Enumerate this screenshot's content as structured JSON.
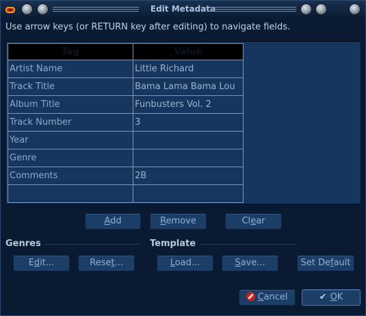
{
  "window": {
    "title": "Edit Metadata"
  },
  "instructions": "Use arrow keys (or RETURN key after editing) to navigate fields.",
  "table": {
    "headers": {
      "tag": "Tag",
      "value": "Value"
    },
    "rows": [
      {
        "tag": "Artist Name",
        "value": "Little Richard"
      },
      {
        "tag": "Track Title",
        "value": "Bama Lama Bama Lou"
      },
      {
        "tag": "Album Title",
        "value": "Funbusters Vol. 2"
      },
      {
        "tag": "Track Number",
        "value": "3"
      },
      {
        "tag": "Year",
        "value": ""
      },
      {
        "tag": "Genre",
        "value": ""
      },
      {
        "tag": "Comments",
        "value": "2B"
      },
      {
        "tag": "",
        "value": ""
      }
    ]
  },
  "buttons": {
    "add": {
      "pre": "",
      "accel": "A",
      "post": "dd"
    },
    "remove": {
      "pre": "",
      "accel": "R",
      "post": "emove"
    },
    "clear": {
      "pre": "Cl",
      "accel": "e",
      "post": "ar"
    },
    "genres_edit": {
      "pre": "E",
      "accel": "d",
      "post": "it..."
    },
    "genres_reset": {
      "pre": "Rese",
      "accel": "t",
      "post": "..."
    },
    "template_load": {
      "pre": "",
      "accel": "L",
      "post": "oad..."
    },
    "template_save": {
      "pre": "",
      "accel": "S",
      "post": "ave..."
    },
    "set_default": {
      "pre": "Set De",
      "accel": "f",
      "post": "ault"
    },
    "cancel": {
      "pre": "",
      "accel": "C",
      "post": "ancel"
    },
    "ok": {
      "pre": "",
      "accel": "O",
      "post": "K"
    }
  },
  "sections": {
    "genres": "Genres",
    "template": "Template"
  },
  "icons": {
    "app": "audacity-icon",
    "cancel": "cancel-icon",
    "ok": "checkmark-icon"
  }
}
